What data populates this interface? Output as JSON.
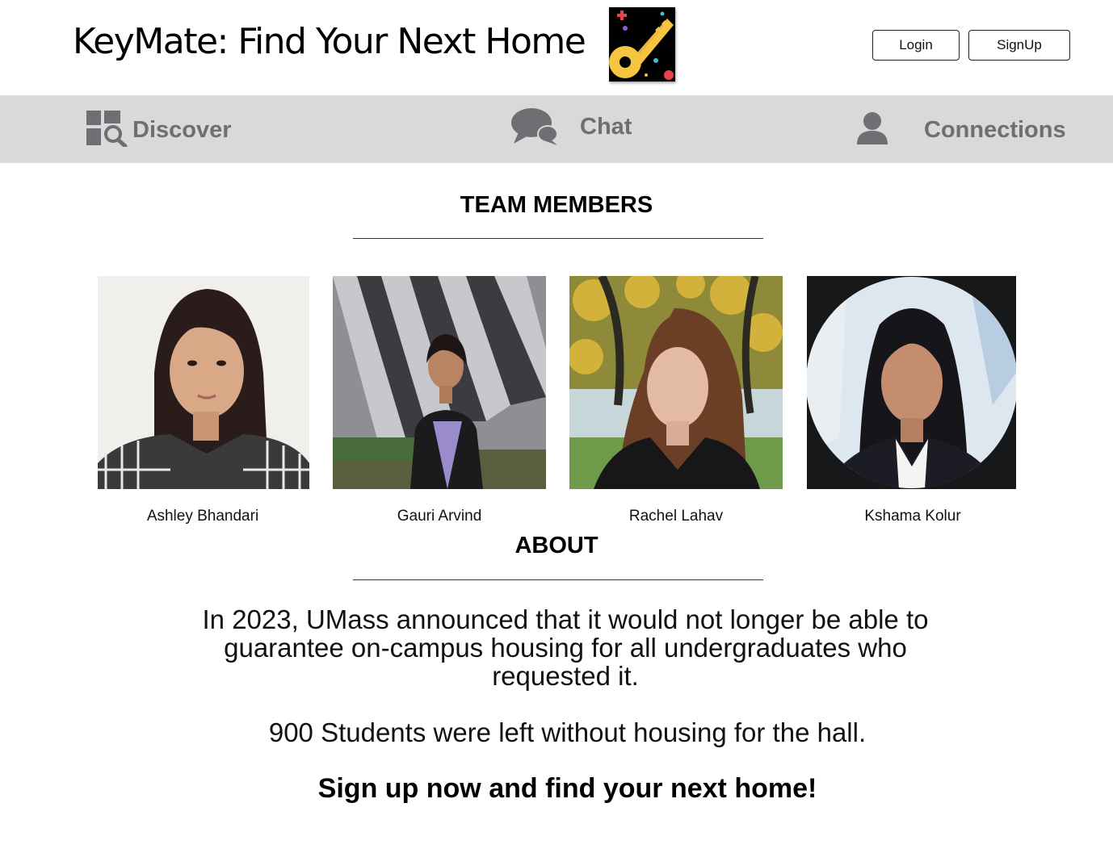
{
  "header": {
    "title": "KeyMate: Find Your Next Home",
    "login_label": "Login",
    "signup_label": "SignUp"
  },
  "nav": {
    "items": [
      {
        "label": "Discover",
        "icon": "discover-search-icon"
      },
      {
        "label": "Chat",
        "icon": "chat-bubbles-icon"
      },
      {
        "label": "Connections",
        "icon": "user-icon"
      }
    ]
  },
  "team": {
    "heading": "TEAM MEMBERS",
    "members": [
      {
        "name": "Ashley Bhandari"
      },
      {
        "name": "Gauri Arvind"
      },
      {
        "name": "Rachel Lahav"
      },
      {
        "name": "Kshama Kolur"
      }
    ]
  },
  "about": {
    "heading": "ABOUT",
    "paragraph1": "In 2023, UMass announced that it would not longer be able to guarantee on-campus housing for all undergraduates who requested it.",
    "paragraph2": "900 Students were left without housing for the hall.",
    "cta": "Sign up now and find your next home!"
  },
  "colors": {
    "navbar_bg": "#d9d9d9",
    "nav_text": "#6e6e73",
    "logo_bg": "#000000",
    "logo_key": "#f5c542"
  }
}
